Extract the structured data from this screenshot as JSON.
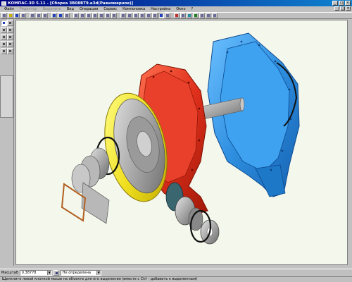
{
  "window": {
    "title": "КОМПАС-3D 5.11 - [Сборка ЗВ08ВТ9.a3d(Равномерное)]",
    "minimize": "_",
    "maximize": "□",
    "close": "×"
  },
  "menu": {
    "items": [
      {
        "label": "Файл"
      },
      {
        "label": "Редактор"
      },
      {
        "label": "Выделить"
      },
      {
        "label": "Вид"
      },
      {
        "label": "Операции"
      },
      {
        "label": "Сервис"
      },
      {
        "label": "Компоновка"
      },
      {
        "label": "Настройка"
      },
      {
        "label": "Окно"
      },
      {
        "label": "?"
      }
    ]
  },
  "status": {
    "scale_label": "Масштаб",
    "scale_value": "0.38778",
    "view_value": "Не определена"
  },
  "hint": "Щелкните левой кнопкой мыши на объекте для его выделения (вместе с Ctrl - добавить к выделенным)",
  "colors": {
    "viewport_bg": "#f4f7ec",
    "blue_housing": "#2f8fe0",
    "red_housing": "#e0301c",
    "yellow_rim": "#f0e020",
    "steel": "#a8a8a8",
    "dark_teal": "#3a6670",
    "gasket": "#b06020"
  }
}
